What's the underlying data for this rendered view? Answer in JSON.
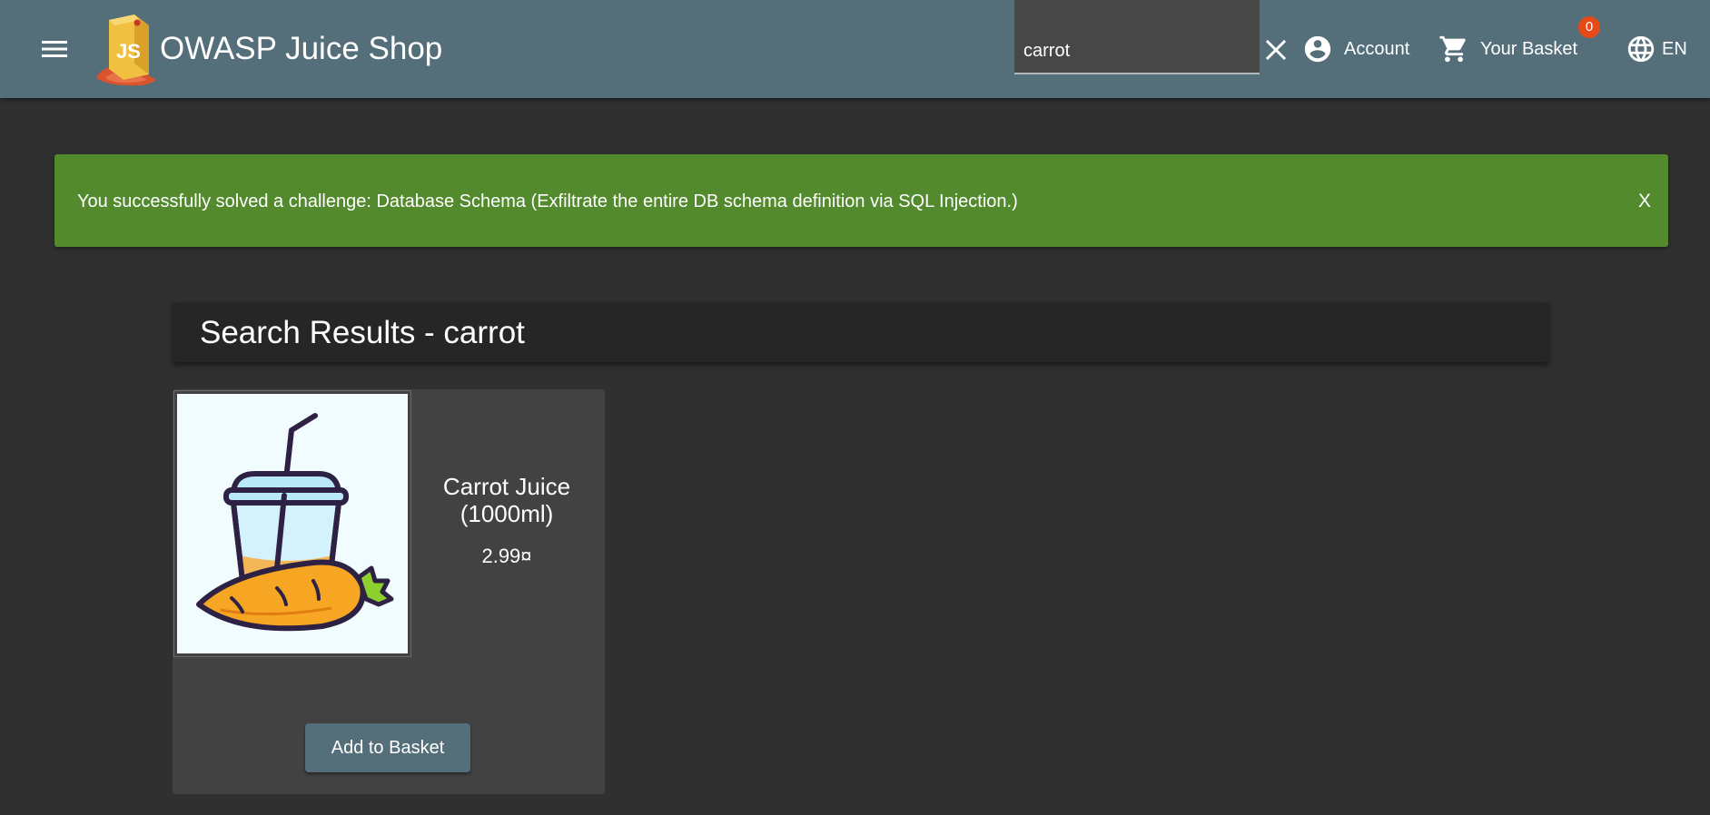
{
  "header": {
    "app_title": "OWASP Juice Shop",
    "menu_icon": "menu-icon",
    "logo_text": "JS",
    "search": {
      "value": "carrot",
      "placeholder": ""
    },
    "account_label": "Account",
    "basket_label": "Your Basket",
    "basket_count": "0",
    "language_label": "EN",
    "colors": {
      "toolbar": "#546e7a",
      "badge": "#e64a19"
    }
  },
  "notification": {
    "message": "You successfully solved a challenge: Database Schema (Exfiltrate the entire DB schema definition via SQL Injection.)",
    "close_label": "X",
    "color": "#538a2d"
  },
  "results": {
    "title": "Search Results - carrot",
    "products": [
      {
        "name": "Carrot Juice (1000ml)",
        "price": "2.99¤",
        "button_label": "Add to Basket"
      }
    ]
  }
}
